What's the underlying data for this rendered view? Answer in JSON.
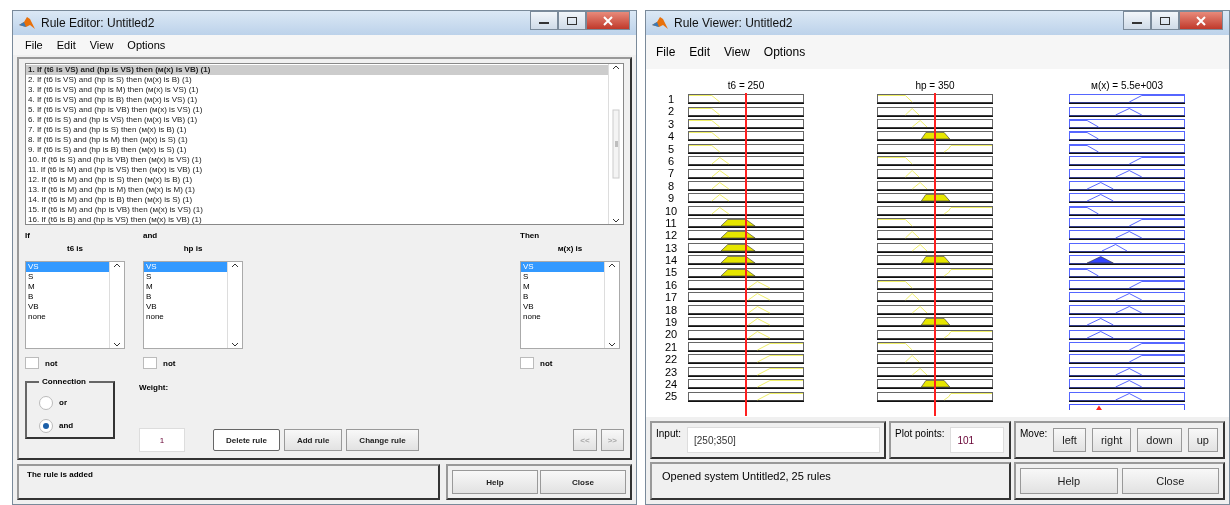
{
  "editor": {
    "title": "Rule Editor: Untitled2",
    "menu": [
      "File",
      "Edit",
      "View",
      "Options"
    ],
    "rules": [
      {
        "text": "1. If (t6 is VS) and (hp is VS) then (м(x) is VB) (1)",
        "selected": true
      },
      {
        "text": "2. If (t6 is VS) and (hp is S) then (м(x) is B) (1)",
        "selected": false
      },
      {
        "text": "3. If (t6 is VS) and (hp is M) then (м(x) is VS) (1)",
        "selected": false
      },
      {
        "text": "4. If (t6 is VS) and (hp is B) then (м(x) is VS) (1)",
        "selected": false
      },
      {
        "text": "5. If (t6 is VS) and (hp is VB) then (м(x) is VS) (1)",
        "selected": false
      },
      {
        "text": "6. If (t6 is S) and (hp is VS) then (м(x) is VB) (1)",
        "selected": false
      },
      {
        "text": "7. If (t6 is S) and (hp is S) then (м(x) is B) (1)",
        "selected": false
      },
      {
        "text": "8. If (t6 is S) and (hp is M) then (м(x) is S) (1)",
        "selected": false
      },
      {
        "text": "9. If (t6 is S) and (hp is B) then (м(x) is S) (1)",
        "selected": false
      },
      {
        "text": "10. If (t6 is S) and (hp is VB) then (м(x) is VS) (1)",
        "selected": false
      },
      {
        "text": "11. If (t6 is M) and (hp is VS) then (м(x) is VB) (1)",
        "selected": false
      },
      {
        "text": "12. If (t6 is M) and (hp is S) then (м(x) is B) (1)",
        "selected": false
      },
      {
        "text": "13. If (t6 is M) and (hp is M) then (м(x) is M) (1)",
        "selected": false
      },
      {
        "text": "14. If (t6 is M) and (hp is B) then (м(x) is S) (1)",
        "selected": false
      },
      {
        "text": "15. If (t6 is M) and (hp is VB) then (м(x) is VS) (1)",
        "selected": false
      },
      {
        "text": "16. If (t6 is B) and (hp is VS) then (м(x) is VB) (1)",
        "selected": false
      }
    ],
    "variables": [
      {
        "connector": "If",
        "heading": "t6 is",
        "not_label": "not",
        "not_checked": false,
        "options": [
          {
            "label": "VS",
            "selected": true
          },
          {
            "label": "S",
            "selected": false
          },
          {
            "label": "M",
            "selected": false
          },
          {
            "label": "B",
            "selected": false
          },
          {
            "label": "VB",
            "selected": false
          },
          {
            "label": "none",
            "selected": false
          }
        ]
      },
      {
        "connector": "and",
        "heading": "hp is",
        "not_label": "not",
        "not_checked": false,
        "options": [
          {
            "label": "VS",
            "selected": true
          },
          {
            "label": "S",
            "selected": false
          },
          {
            "label": "M",
            "selected": false
          },
          {
            "label": "B",
            "selected": false
          },
          {
            "label": "VB",
            "selected": false
          },
          {
            "label": "none",
            "selected": false
          }
        ]
      },
      {
        "connector": "Then",
        "heading": "м(x) is",
        "not_label": "not",
        "not_checked": false,
        "options": [
          {
            "label": "VS",
            "selected": true
          },
          {
            "label": "S",
            "selected": false
          },
          {
            "label": "M",
            "selected": false
          },
          {
            "label": "B",
            "selected": false
          },
          {
            "label": "VB",
            "selected": false
          },
          {
            "label": "none",
            "selected": false
          }
        ]
      }
    ],
    "connection": {
      "title": "Connection",
      "options": [
        {
          "label": "or",
          "selected": false
        },
        {
          "label": "and",
          "selected": true
        }
      ]
    },
    "weight": {
      "label": "Weight:",
      "value": "1"
    },
    "buttons": [
      {
        "label": "Delete rule",
        "focused": true
      },
      {
        "label": "Add rule",
        "focused": false
      },
      {
        "label": "Change rule",
        "focused": false
      }
    ],
    "nav_buttons": [
      {
        "label": "<<",
        "disabled": true
      },
      {
        "label": ">>",
        "disabled": true
      }
    ],
    "status": "The rule is added",
    "footer_buttons": [
      "Help",
      "Close"
    ]
  },
  "viewer": {
    "title": "Rule Viewer: Untitled2",
    "menu": [
      "File",
      "Edit",
      "View",
      "Options"
    ],
    "headers": [
      "t6 = 250",
      "hp = 350",
      "м(x) = 5.5e+003"
    ],
    "rules": [
      {
        "number": "1",
        "plots": [
          {
            "kind": "verysmall",
            "fired": false
          },
          {
            "kind": "verysmall",
            "fired": false
          },
          {
            "kind": "verybig",
            "fired": false
          }
        ]
      },
      {
        "number": "2",
        "plots": [
          {
            "kind": "verysmall",
            "fired": false
          },
          {
            "kind": "small",
            "fired": false
          },
          {
            "kind": "big",
            "fired": false
          }
        ]
      },
      {
        "number": "3",
        "plots": [
          {
            "kind": "verysmall",
            "fired": false
          },
          {
            "kind": "medium",
            "fired": false
          },
          {
            "kind": "verysmall",
            "fired": false
          }
        ]
      },
      {
        "number": "4",
        "plots": [
          {
            "kind": "verysmall",
            "fired": false
          },
          {
            "kind": "big",
            "fired": true
          },
          {
            "kind": "verysmall",
            "fired": false
          }
        ]
      },
      {
        "number": "5",
        "plots": [
          {
            "kind": "verysmall",
            "fired": false
          },
          {
            "kind": "verybig",
            "fired": false
          },
          {
            "kind": "verysmall",
            "fired": false
          }
        ]
      },
      {
        "number": "6",
        "plots": [
          {
            "kind": "small",
            "fired": false
          },
          {
            "kind": "verysmall",
            "fired": false
          },
          {
            "kind": "verybig",
            "fired": false
          }
        ]
      },
      {
        "number": "7",
        "plots": [
          {
            "kind": "small",
            "fired": false
          },
          {
            "kind": "small",
            "fired": false
          },
          {
            "kind": "big",
            "fired": false
          }
        ]
      },
      {
        "number": "8",
        "plots": [
          {
            "kind": "small",
            "fired": false
          },
          {
            "kind": "medium",
            "fired": false
          },
          {
            "kind": "small",
            "fired": false
          }
        ]
      },
      {
        "number": "9",
        "plots": [
          {
            "kind": "small",
            "fired": false
          },
          {
            "kind": "big",
            "fired": true
          },
          {
            "kind": "small",
            "fired": false
          }
        ]
      },
      {
        "number": "10",
        "plots": [
          {
            "kind": "small",
            "fired": false
          },
          {
            "kind": "verybig",
            "fired": false
          },
          {
            "kind": "verysmall",
            "fired": false
          }
        ]
      },
      {
        "number": "11",
        "plots": [
          {
            "kind": "medium",
            "fired": true
          },
          {
            "kind": "verysmall",
            "fired": false
          },
          {
            "kind": "verybig",
            "fired": false
          }
        ]
      },
      {
        "number": "12",
        "plots": [
          {
            "kind": "medium",
            "fired": true
          },
          {
            "kind": "small",
            "fired": false
          },
          {
            "kind": "big",
            "fired": false
          }
        ]
      },
      {
        "number": "13",
        "plots": [
          {
            "kind": "medium",
            "fired": true
          },
          {
            "kind": "medium",
            "fired": false
          },
          {
            "kind": "medium",
            "fired": false
          }
        ]
      },
      {
        "number": "14",
        "plots": [
          {
            "kind": "medium",
            "fired": true
          },
          {
            "kind": "big",
            "fired": true
          },
          {
            "kind": "small",
            "fired": true
          }
        ]
      },
      {
        "number": "15",
        "plots": [
          {
            "kind": "medium",
            "fired": true
          },
          {
            "kind": "verybig",
            "fired": false
          },
          {
            "kind": "verysmall",
            "fired": false
          }
        ]
      },
      {
        "number": "16",
        "plots": [
          {
            "kind": "big",
            "fired": false
          },
          {
            "kind": "verysmall",
            "fired": false
          },
          {
            "kind": "verybig",
            "fired": false
          }
        ]
      },
      {
        "number": "17",
        "plots": [
          {
            "kind": "big",
            "fired": false
          },
          {
            "kind": "small",
            "fired": false
          },
          {
            "kind": "big",
            "fired": false
          }
        ]
      },
      {
        "number": "18",
        "plots": [
          {
            "kind": "big",
            "fired": false
          },
          {
            "kind": "medium",
            "fired": false
          },
          {
            "kind": "big",
            "fired": false
          }
        ]
      },
      {
        "number": "19",
        "plots": [
          {
            "kind": "big",
            "fired": false
          },
          {
            "kind": "big",
            "fired": true
          },
          {
            "kind": "small",
            "fired": false
          }
        ]
      },
      {
        "number": "20",
        "plots": [
          {
            "kind": "big",
            "fired": false
          },
          {
            "kind": "verybig",
            "fired": false
          },
          {
            "kind": "small",
            "fired": false
          }
        ]
      },
      {
        "number": "21",
        "plots": [
          {
            "kind": "verybig",
            "fired": false
          },
          {
            "kind": "verysmall",
            "fired": false
          },
          {
            "kind": "verybig",
            "fired": false
          }
        ]
      },
      {
        "number": "22",
        "plots": [
          {
            "kind": "verybig",
            "fired": false
          },
          {
            "kind": "small",
            "fired": false
          },
          {
            "kind": "verybig",
            "fired": false
          }
        ]
      },
      {
        "number": "23",
        "plots": [
          {
            "kind": "verybig",
            "fired": false
          },
          {
            "kind": "medium",
            "fired": false
          },
          {
            "kind": "big",
            "fired": false
          }
        ]
      },
      {
        "number": "24",
        "plots": [
          {
            "kind": "verybig",
            "fired": false
          },
          {
            "kind": "big",
            "fired": true
          },
          {
            "kind": "big",
            "fired": false
          }
        ]
      },
      {
        "number": "25",
        "plots": [
          {
            "kind": "verybig",
            "fired": false
          },
          {
            "kind": "verybig",
            "fired": false
          },
          {
            "kind": "big",
            "fired": false
          }
        ]
      }
    ],
    "input": {
      "label": "Input:",
      "value": "[250;350]"
    },
    "plot_points": {
      "label": "Plot points:",
      "value": "101"
    },
    "move": {
      "label": "Move:",
      "buttons": [
        "left",
        "right",
        "down",
        "up"
      ]
    },
    "status": "Opened system Untitled2, 25 rules",
    "footer_buttons": [
      "Help",
      "Close"
    ]
  }
}
